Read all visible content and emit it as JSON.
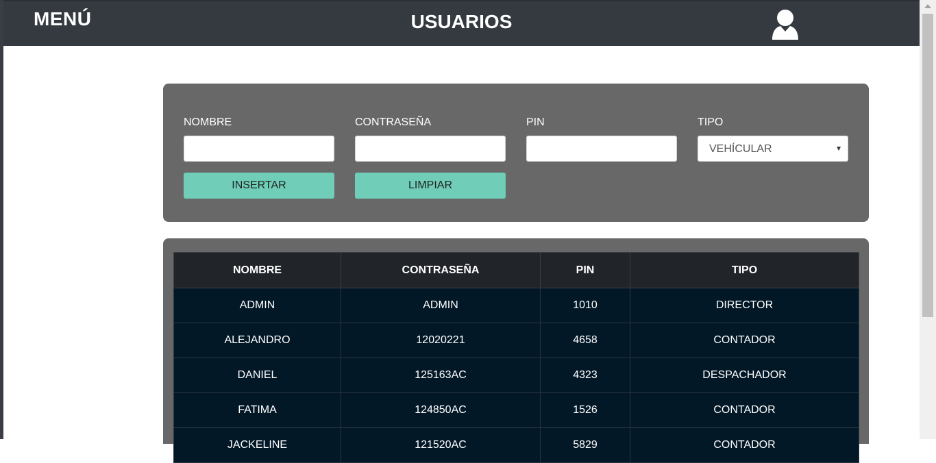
{
  "header": {
    "menu_label": "MENÚ",
    "title": "USUARIOS",
    "user_icon": "user-icon"
  },
  "form": {
    "fields": [
      {
        "label": "NOMBRE",
        "value": ""
      },
      {
        "label": "CONTRASEÑA",
        "value": ""
      },
      {
        "label": "PIN",
        "value": ""
      },
      {
        "label": "TIPO",
        "selected": "VEHÍCULAR"
      }
    ],
    "insert_label": "INSERTAR",
    "clear_label": "LIMPIAR"
  },
  "table": {
    "headers": [
      "NOMBRE",
      "CONTRASEÑA",
      "PIN",
      "TIPO"
    ],
    "rows": [
      [
        "ADMIN",
        "ADMIN",
        "1010",
        "DIRECTOR"
      ],
      [
        "ALEJANDRO",
        "12020221",
        "4658",
        "CONTADOR"
      ],
      [
        "DANIEL",
        "125163AC",
        "4323",
        "DESPACHADOR"
      ],
      [
        "FATIMA",
        "124850AC",
        "1526",
        "CONTADOR"
      ],
      [
        "JACKELINE",
        "121520AC",
        "5829",
        "CONTADOR"
      ]
    ]
  },
  "colors": {
    "header_bg": "#343a40",
    "panel_bg": "#686868",
    "button_bg": "#6fcdb8",
    "table_row_bg": "#031827",
    "table_head_bg": "#212529"
  }
}
